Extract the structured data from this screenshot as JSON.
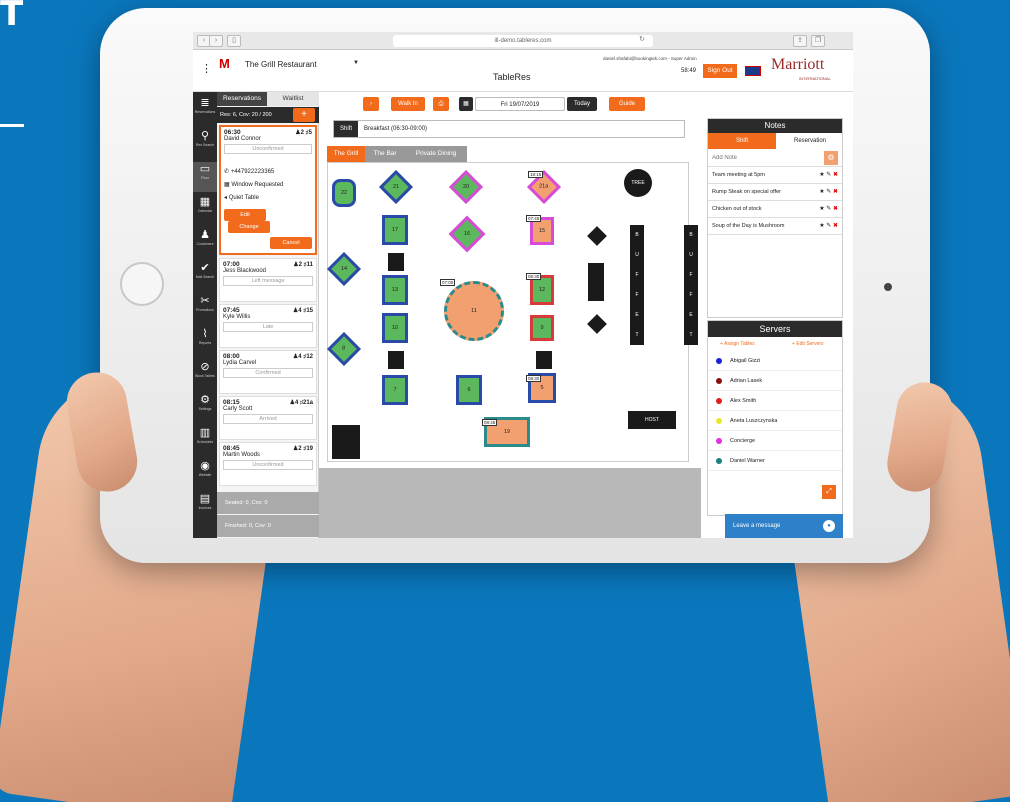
{
  "browser": {
    "url": "ill-demo.tableres.com"
  },
  "header": {
    "restaurant": "The Grill Restaurant",
    "app_title": "TableRes",
    "user": "daniel.shafabi@bookingtek.com - Super Admin",
    "time": "58:49",
    "signout": "Sign Out",
    "brand": "Marriott",
    "brand_sub": "INTERNATIONAL"
  },
  "sidebar": [
    {
      "icon": "≣",
      "label": "Reservations"
    },
    {
      "icon": "⚲",
      "label": "Res Search"
    },
    {
      "icon": "▭",
      "label": "Floor"
    },
    {
      "icon": "▦",
      "label": "Calendar"
    },
    {
      "icon": "♟",
      "label": "Customers"
    },
    {
      "icon": "✔",
      "label": "Mail Search"
    },
    {
      "icon": "✂",
      "label": "Promotions"
    },
    {
      "icon": "⌇",
      "label": "Reports"
    },
    {
      "icon": "⊘",
      "label": "Block Tables"
    },
    {
      "icon": "⚙",
      "label": "Settings"
    },
    {
      "icon": "▥",
      "label": "Schedules"
    },
    {
      "icon": "◉",
      "label": "Website"
    },
    {
      "icon": "▤",
      "label": "Invoices"
    }
  ],
  "res_panel": {
    "tab_reservations": "Reservations",
    "tab_waitlist": "Waitlist",
    "summary": "Res: 6, Cov: 20 / 200",
    "plus": "+",
    "selected": {
      "time": "06:30",
      "covers": "2",
      "table": "5",
      "name": "David Connor",
      "status": "Unconfirmed",
      "phone": "+447922223365",
      "note1": "Window Requested",
      "note2": "Quiet Table",
      "edit": "Edit",
      "change": "Change",
      "cancel": "Cancel"
    },
    "cards": [
      {
        "time": "07:00",
        "covers": "2",
        "table": "11",
        "name": "Jess Blackwood",
        "status": "Left message"
      },
      {
        "time": "07:45",
        "covers": "4",
        "table": "15",
        "name": "Kyle Willis",
        "status": "Late"
      },
      {
        "time": "08:00",
        "covers": "4",
        "table": "12",
        "name": "Lydia Carvel",
        "status": "Confirmed"
      },
      {
        "time": "08:15",
        "covers": "4",
        "table": "21a",
        "name": "Carly Scott",
        "status": "Arrived"
      },
      {
        "time": "08:45",
        "covers": "2",
        "table": "19",
        "name": "Martin Woods",
        "status": "Unconfirmed"
      }
    ],
    "seated": "Seated: 0, Cov: 0",
    "finished": "Finished: 0, Cov: 0"
  },
  "toolbar": {
    "walkin": "Walk In",
    "date": "Fri 19/07/2019",
    "today": "Today",
    "guide": "Guide"
  },
  "shift": {
    "label": "Shift",
    "value": "Breakfast (06:30-09:00)"
  },
  "rooms": [
    "The Grill",
    "The Bar",
    "Private Dining"
  ],
  "floor": {
    "tables": [
      "22",
      "21",
      "20",
      "18:15",
      "21a",
      "17",
      "16",
      "07:45",
      "15",
      "14",
      "07:00",
      "11",
      "08:30",
      "12",
      "10",
      "9",
      "8",
      "7",
      "6",
      "08:30",
      "5",
      "08:45",
      "19"
    ],
    "tree": "TREE",
    "host": "HOST",
    "buffet": [
      "B",
      "U",
      "F",
      "F",
      "E",
      "T"
    ]
  },
  "notes": {
    "title": "Notes",
    "tab_shift": "Shift",
    "tab_res": "Reservation",
    "placeholder": "Add Note",
    "items": [
      "Team meeting at 5pm",
      "Rump Steak on special offer",
      "Chicken out of stock",
      "Soup of the Day is Mushroom"
    ]
  },
  "servers": {
    "title": "Servers",
    "assign": "+ Assign Tables",
    "edit": "+ Edit Servers",
    "list": [
      {
        "name": "Abigail Gizzi",
        "color": "#1a22d8"
      },
      {
        "name": "Adrian Lasek",
        "color": "#8a1010"
      },
      {
        "name": "Alex Smith",
        "color": "#e01e1e"
      },
      {
        "name": "Aneta Luszczynska",
        "color": "#e8e82a"
      },
      {
        "name": "Concierge",
        "color": "#e030e0"
      },
      {
        "name": "Daniel Warner",
        "color": "#1a8080"
      }
    ]
  },
  "chat": {
    "label": "Leave a message"
  },
  "fragments": {
    "letter": "T"
  }
}
